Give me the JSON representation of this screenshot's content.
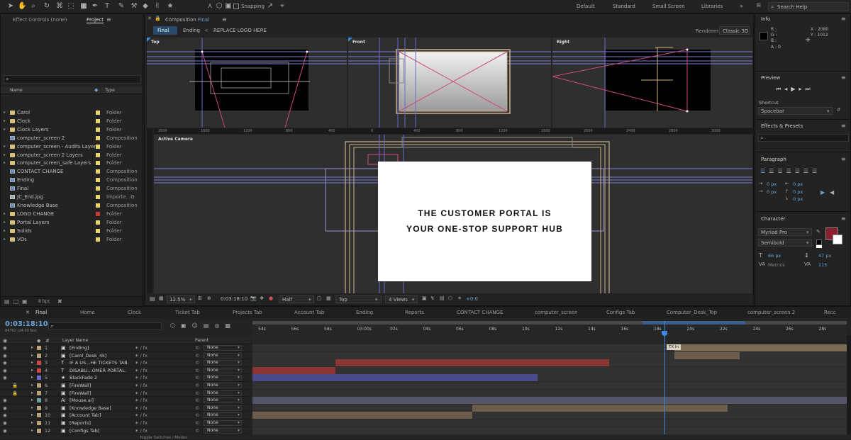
{
  "toolbar": {
    "snapping": "Snapping",
    "workspaces": [
      "Default",
      "Standard",
      "Small Screen",
      "Libraries"
    ],
    "search_placeholder": "Search Help"
  },
  "project": {
    "tabs": [
      "Effect Controls (none)",
      "Project"
    ],
    "search_placeholder": "",
    "columns": {
      "name": "Name",
      "type": "Type"
    },
    "items": [
      {
        "name": "Carol",
        "type": "Folder",
        "kind": "folder",
        "label": "#e8d66a"
      },
      {
        "name": "Clock",
        "type": "Folder",
        "kind": "folder",
        "label": "#e8d66a"
      },
      {
        "name": "Clock Layers",
        "type": "Folder",
        "kind": "folder",
        "label": "#e8d66a"
      },
      {
        "name": "computer_screen 2",
        "type": "Composition",
        "kind": "comp",
        "label": "#e8d66a"
      },
      {
        "name": "computer_screen - Audits Layers",
        "type": "Folder",
        "kind": "folder",
        "label": "#e8d66a"
      },
      {
        "name": "computer_screen 2 Layers",
        "type": "Folder",
        "kind": "folder",
        "label": "#e8d66a"
      },
      {
        "name": "computer_screen_safe Layers",
        "type": "Folder",
        "kind": "folder",
        "label": "#e8d66a"
      },
      {
        "name": "CONTACT CHANGE",
        "type": "Composition",
        "kind": "comp",
        "label": "#e8d66a"
      },
      {
        "name": "Ending",
        "type": "Composition",
        "kind": "comp",
        "label": "#e8d66a"
      },
      {
        "name": "Final",
        "type": "Composition",
        "kind": "comp",
        "label": "#e8d66a"
      },
      {
        "name": "JC_End.jpg",
        "type": "Importe...G",
        "kind": "img",
        "label": "#e8d66a"
      },
      {
        "name": "Knowledge Base",
        "type": "Composition",
        "kind": "comp",
        "label": "#e8d66a"
      },
      {
        "name": "LOGO CHANGE",
        "type": "Folder",
        "kind": "folder",
        "label": "#c83a3a"
      },
      {
        "name": "Portal Layers",
        "type": "Folder",
        "kind": "folder",
        "label": "#e8d66a"
      },
      {
        "name": "Solids",
        "type": "Folder",
        "kind": "folder",
        "label": "#e8d66a"
      },
      {
        "name": "VOs",
        "type": "Folder",
        "kind": "folder",
        "label": "#e8d66a"
      }
    ],
    "bpc": "8 bpc"
  },
  "composition": {
    "panel_label": "Composition",
    "comp_name": "Final",
    "breadcrumbs": [
      "Final",
      "Ending",
      "REPLACE LOGO HERE"
    ],
    "renderer_label": "Renderer:",
    "renderer": "Classic 3D",
    "views": [
      "Top",
      "Front",
      "Right"
    ],
    "active_view": "Active Camera",
    "ruler_top": [
      "2600",
      "1600",
      "1400",
      "1200",
      "1000",
      "800",
      "600",
      "400"
    ],
    "ruler_mid": [
      "2000",
      "1600",
      "1200",
      "800",
      "400",
      "0",
      "400",
      "800",
      "1200",
      "1600",
      "2000",
      "2400",
      "2800",
      "3000"
    ],
    "title_line1": "THE CUSTOMER PORTAL IS",
    "title_line2": "YOUR ONE-STOP SUPPORT HUB",
    "footer": {
      "zoom": "12.5%",
      "timecode": "0:03:18:10",
      "resolution": "Half",
      "view": "Top",
      "view_count": "4 Views",
      "exposure": "+0.0"
    }
  },
  "info": {
    "title": "Info",
    "r": "R :",
    "g": "G :",
    "b": "B :",
    "a": "A : 0",
    "x": "X : 2080",
    "y": "Y : 1012"
  },
  "preview": {
    "title": "Preview",
    "shortcut_label": "Shortcut",
    "shortcut": "Spacebar"
  },
  "effects": {
    "title": "Effects & Presets",
    "search_placeholder": ""
  },
  "paragraph": {
    "title": "Paragraph",
    "values": [
      "0 px",
      "0 px",
      "0 px",
      "0 px",
      "0 px"
    ]
  },
  "character": {
    "title": "Character",
    "font": "Myriad Pro",
    "style": "Semibold",
    "size": "66 px",
    "leading": "47 px",
    "kerning": "Metrics",
    "tracking": "115",
    "fill": "#8b1f2e"
  },
  "timeline": {
    "tabs": [
      "Final",
      "Home",
      "Clock",
      "Ticket Tab",
      "Projects Tab",
      "Account Tab",
      "Ending",
      "Reports",
      "CONTACT CHANGE",
      "computer_screen",
      "Configs Tab",
      "Computer_Desk_Top",
      "computer_screen 2",
      "Recc"
    ],
    "timecode": "0:03:18:10",
    "fps": "04762 (24.00 fps)",
    "search_placeholder": "",
    "col_layer": "Layer Name",
    "col_parent": "Parent",
    "ruler": [
      "54s",
      "56s",
      "58s",
      "03:00s",
      "02s",
      "04s",
      "06s",
      "08s",
      "10s",
      "12s",
      "14s",
      "16s",
      "18s",
      "20s",
      "22s",
      "24s",
      "26s",
      "28s"
    ],
    "marker": "TX In",
    "toggle": "Toggle Switches / Modes",
    "layers": [
      {
        "num": "1",
        "name": "[Ending]",
        "label": "#b9a27a",
        "kind": "comp",
        "parent": "None",
        "bar": [
          0.71,
          1.0
        ],
        "barcolor": "#7a6b55"
      },
      {
        "num": "2",
        "name": "[Carol_Desk_4k]",
        "label": "#b9a27a",
        "kind": "comp",
        "parent": "None",
        "bar": [
          0.71,
          0.82
        ],
        "barcolor": "#6b5f4c"
      },
      {
        "num": "3",
        "name": "IF A US...HE TICKETS TAB.",
        "label": "#c84a4a",
        "kind": "text",
        "parent": "None",
        "bar": [
          0.14,
          0.6
        ],
        "barcolor": "#8b3535"
      },
      {
        "num": "4",
        "name": "DISABLI...OMER PORTAL.",
        "label": "#c84a4a",
        "kind": "text",
        "parent": "None",
        "bar": [
          0.0,
          0.14
        ],
        "barcolor": "#8b3535"
      },
      {
        "num": "5",
        "name": "BlackFade 2",
        "label": "#6b6bd0",
        "kind": "star",
        "parent": "None",
        "bar": [
          0.0,
          0.48
        ],
        "barcolor": "#4a4a8a"
      },
      {
        "num": "6",
        "name": "[FireWall]",
        "label": "#b9a27a",
        "kind": "comp",
        "parent": "None",
        "bar": [
          0,
          0
        ],
        "barcolor": "#6b5f4c"
      },
      {
        "num": "7",
        "name": "[FireWall]",
        "label": "#b9a27a",
        "kind": "comp",
        "parent": "None",
        "bar": [
          0,
          0
        ],
        "barcolor": "#6b5f4c"
      },
      {
        "num": "8",
        "name": "[Mouse.ai]",
        "label": "#6fa0a0",
        "kind": "ai",
        "parent": "None",
        "bar": [
          0.0,
          1.0
        ],
        "barcolor": "#55556a"
      },
      {
        "num": "9",
        "name": "[Knowledge Base]",
        "label": "#b9a27a",
        "kind": "comp",
        "parent": "None",
        "bar": [
          0.37,
          0.8
        ],
        "barcolor": "#6b5f4c"
      },
      {
        "num": "10",
        "name": "[Account Tab]",
        "label": "#b9a27a",
        "kind": "comp",
        "parent": "None",
        "bar": [
          0.0,
          0.37
        ],
        "barcolor": "#6b5f4c"
      },
      {
        "num": "11",
        "name": "[Reports]",
        "label": "#b9a27a",
        "kind": "comp",
        "parent": "None",
        "bar": [
          0,
          0
        ],
        "barcolor": "#6b5f4c"
      },
      {
        "num": "12",
        "name": "[Configs Tab]",
        "label": "#b9a27a",
        "kind": "comp",
        "parent": "None",
        "bar": [
          0,
          0
        ],
        "barcolor": "#6b5f4c"
      }
    ]
  }
}
